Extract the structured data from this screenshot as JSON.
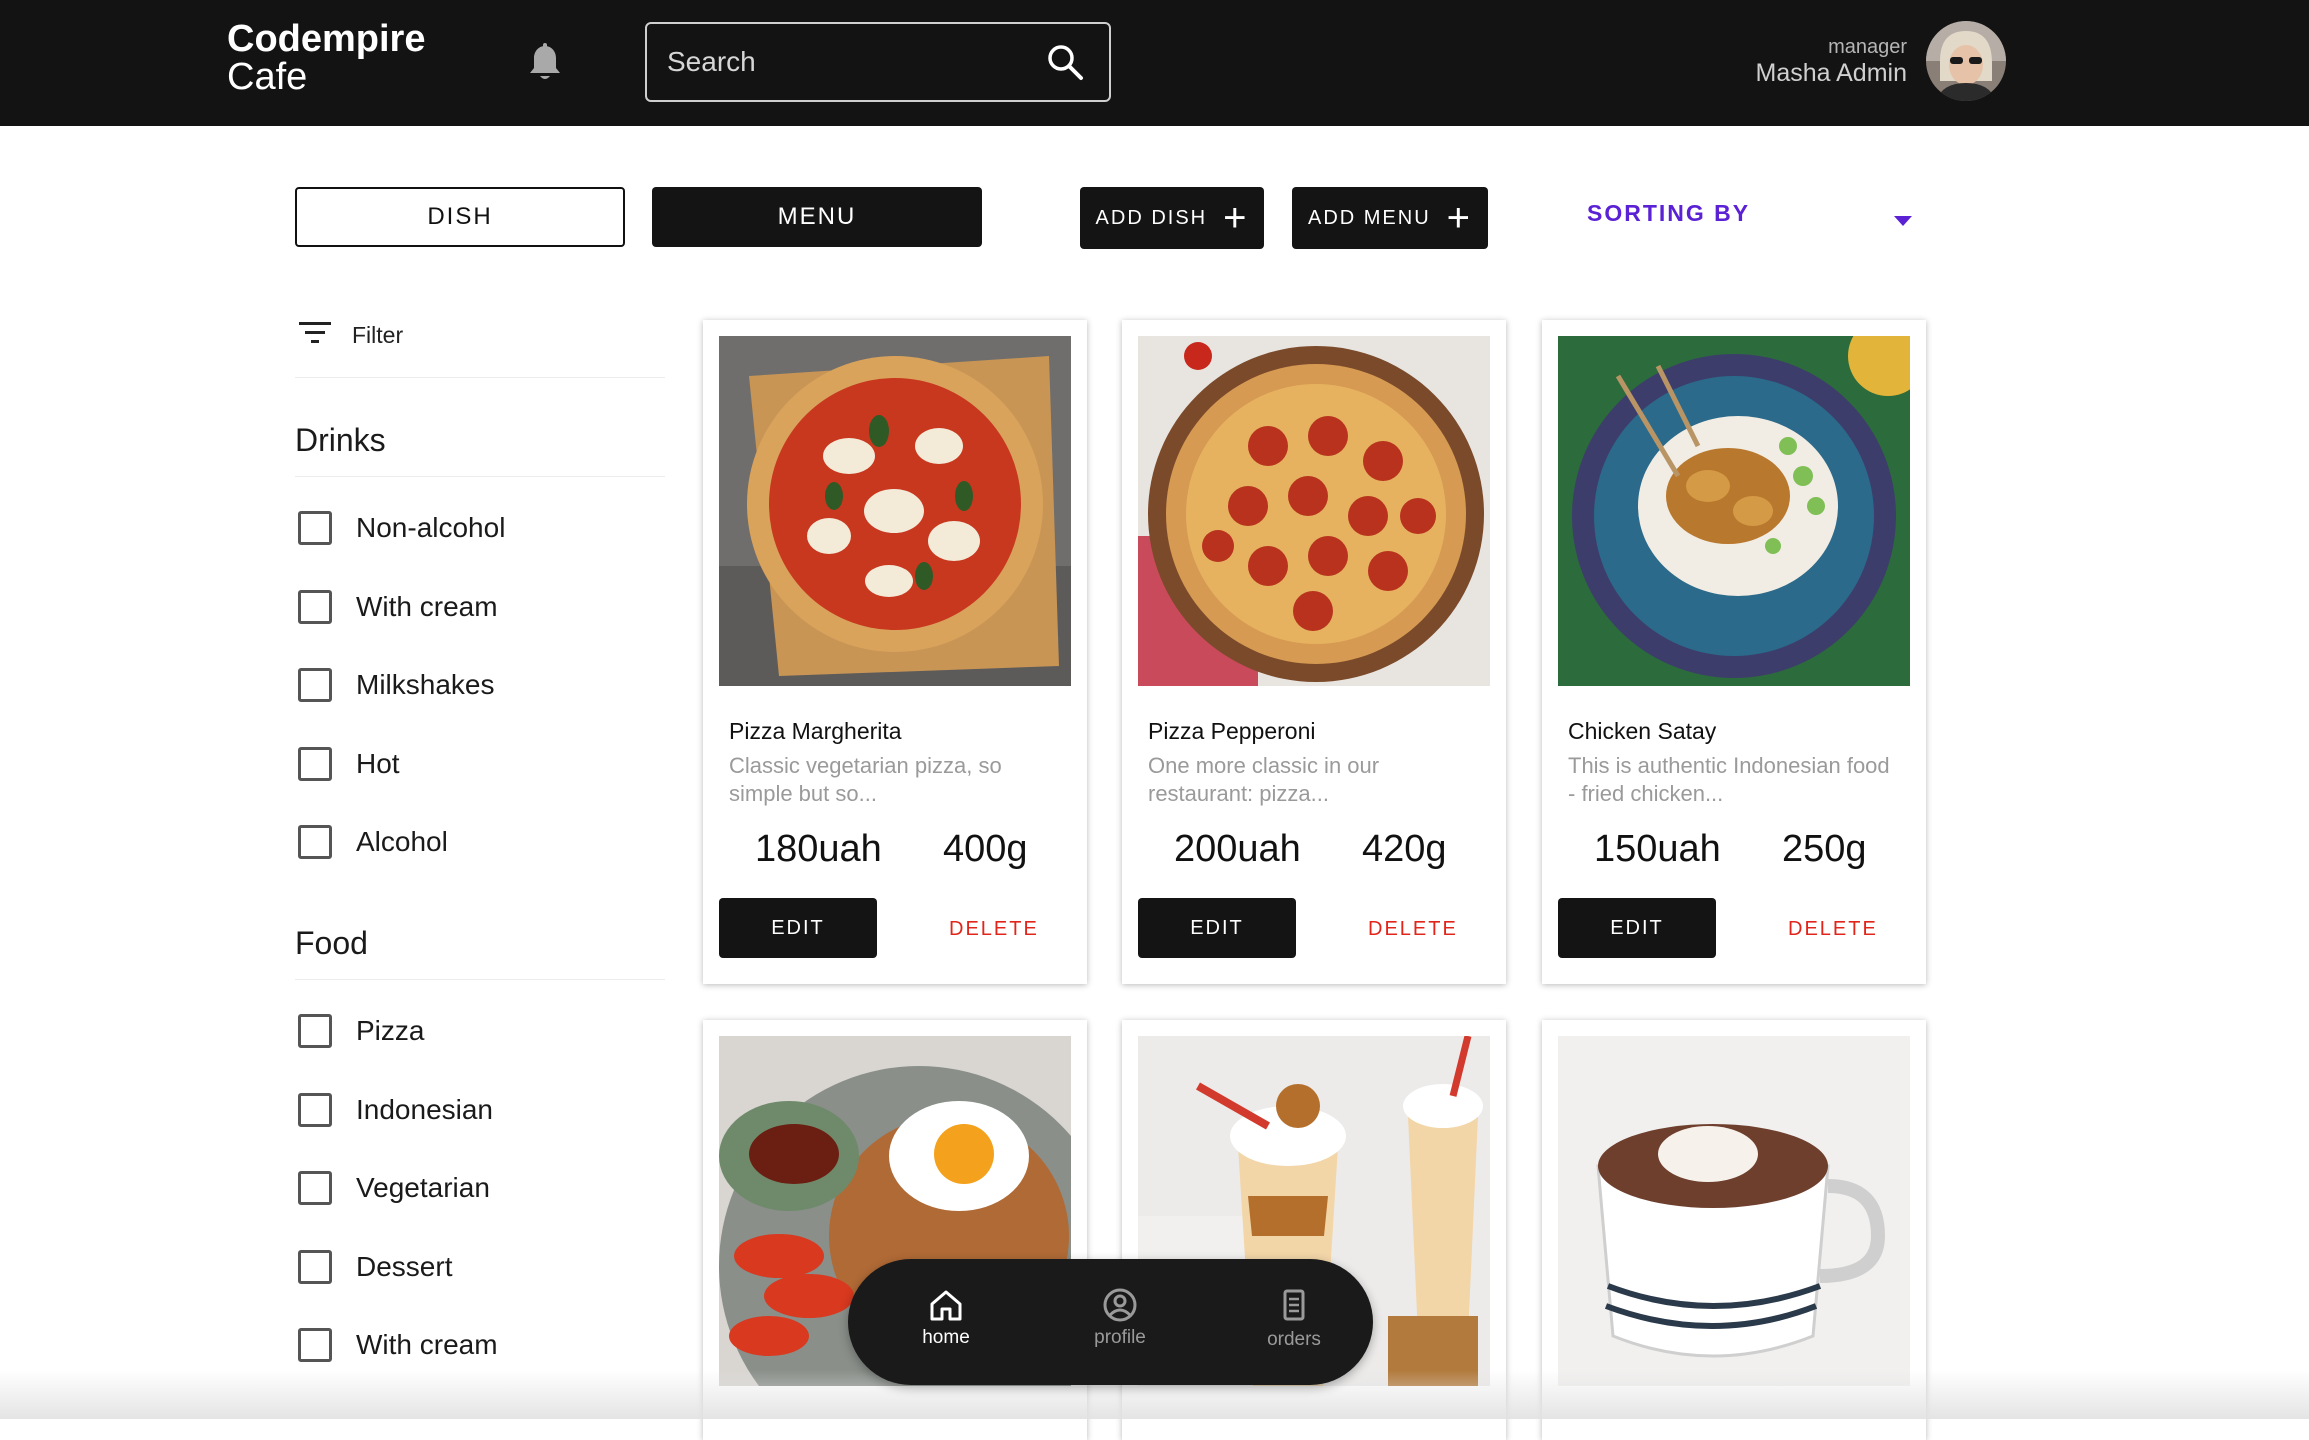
{
  "header": {
    "brand_line1": "Codempire",
    "brand_line2": "Cafe",
    "search_placeholder": "Search",
    "user_role": "manager",
    "user_name": "Masha Admin"
  },
  "toolbar": {
    "dish_label": "DISH",
    "menu_label": "MENU",
    "add_dish_label": "ADD DISH",
    "add_menu_label": "ADD MENU",
    "sorting_label": "SORTING BY"
  },
  "sidebar": {
    "filter_label": "Filter",
    "groups": [
      {
        "title": "Drinks",
        "items": [
          "Non-alcohol",
          "With cream",
          "Milkshakes",
          "Hot",
          "Alcohol"
        ]
      },
      {
        "title": "Food",
        "items": [
          "Pizza",
          "Indonesian",
          "Vegetarian",
          "Dessert",
          "With cream"
        ]
      }
    ]
  },
  "cards": [
    {
      "title": "Pizza Margherita",
      "desc": "Classic vegetarian pizza, so simple but so...",
      "price": "180uah",
      "weight": "400g",
      "edit": "EDIT",
      "delete": "DELETE",
      "image": "pizza-margherita-photo"
    },
    {
      "title": "Pizza Pepperoni",
      "desc": "One more classic in our restaurant: pizza...",
      "price": "200uah",
      "weight": "420g",
      "edit": "EDIT",
      "delete": "DELETE",
      "image": "pizza-pepperoni-photo"
    },
    {
      "title": "Chicken Satay",
      "desc": "This is authentic Indonesian food - fried chicken...",
      "price": "150uah",
      "weight": "250g",
      "edit": "EDIT",
      "delete": "DELETE",
      "image": "chicken-satay-photo"
    },
    {
      "image": "nasi-goreng-photo"
    },
    {
      "image": "milkshakes-photo"
    },
    {
      "image": "hot-chocolate-photo"
    }
  ],
  "bottom_nav": [
    {
      "label": "home",
      "icon": "home-icon",
      "active": true
    },
    {
      "label": "profile",
      "icon": "profile-icon",
      "active": false
    },
    {
      "label": "orders",
      "icon": "orders-icon",
      "active": false
    }
  ],
  "colors": {
    "header_bg": "#131313",
    "accent_purple": "#5b21d4",
    "delete_red": "#e1251b",
    "button_dark": "#141414"
  }
}
